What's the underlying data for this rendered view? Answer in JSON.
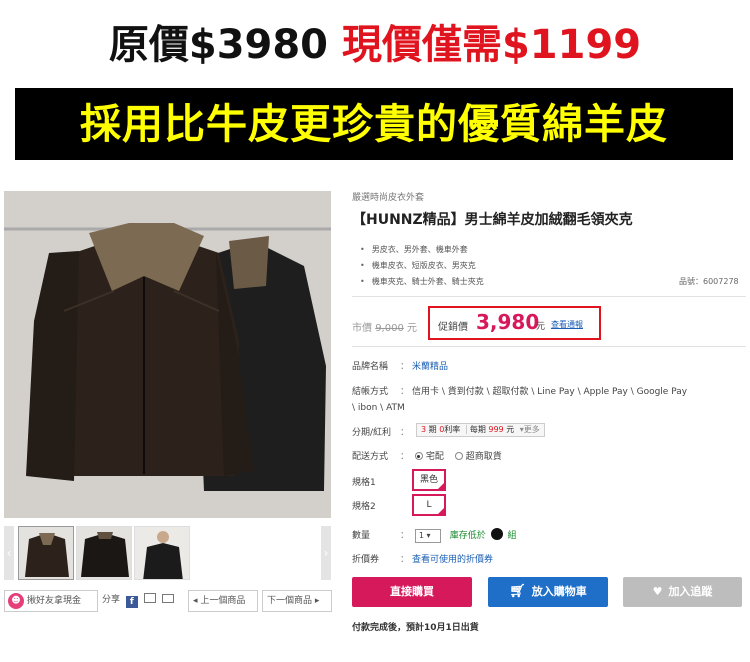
{
  "headline": {
    "original_price": "原價$3980",
    "current_price": "現價僅需$1199"
  },
  "banner": {
    "text": "採用比牛皮更珍貴的優質綿羊皮"
  },
  "product": {
    "category": "嚴選時尚皮衣外套",
    "title": "【HUNNZ精品】男士綿羊皮加絨翻毛領夾克",
    "features": [
      "男皮衣、男外套、機車外套",
      "機車皮衣、短版皮衣、男夾克",
      "機車夾克、騎士外套、騎士夾克"
    ],
    "item_no": "品號：6007278"
  },
  "pricing": {
    "list_label": "市價",
    "list_value": "9,000",
    "list_unit": "元",
    "promo_label": "促銷價",
    "promo_value": "3,980",
    "promo_unit": "元",
    "promo_link": "查看通報"
  },
  "details": {
    "brand_label": "品牌名稱",
    "brand_value": "米蘭精品",
    "payment_label": "結帳方式",
    "payment_line1": "信用卡 \\ 貨到付款 \\ 超取付款 \\ Line Pay \\ Apple Pay \\ Google Pay",
    "payment_line2": "\\ ibon \\ ATM",
    "installment_label": "分期/紅利",
    "installment_text_a": "3",
    "installment_text_b": "期",
    "installment_text_c": "0",
    "installment_text_d": "利率",
    "installment_text_e": "每期",
    "installment_text_f": "999",
    "installment_text_g": "元",
    "installment_more": "▾更多",
    "delivery_label": "配送方式",
    "delivery_home": "宅配",
    "delivery_store": "超商取貨",
    "spec1_label": "規格1",
    "spec1_value": "黑色",
    "spec2_label": "規格2",
    "spec2_value": "L",
    "qty_label": "數量",
    "qty_value": "1",
    "stock_text": "庫存低於",
    "stock_unit": "組",
    "coupon_label": "折價券",
    "coupon_link": "查看可使用的折價券"
  },
  "buttons": {
    "buy": "直接購買",
    "cart": "放入購物車",
    "wish": "加入追蹤"
  },
  "share": {
    "invite": "揪好友拿現金",
    "share_label": "分享",
    "prev": "上一個商品",
    "next": "下一個商品"
  },
  "ship_note": "付款完成後，預計10月1日出貨",
  "colors": {
    "accent_pink": "#d6195a",
    "cart_blue": "#1f6fc8",
    "headline_red": "#e0141e",
    "banner_yellow": "#ffff00"
  }
}
